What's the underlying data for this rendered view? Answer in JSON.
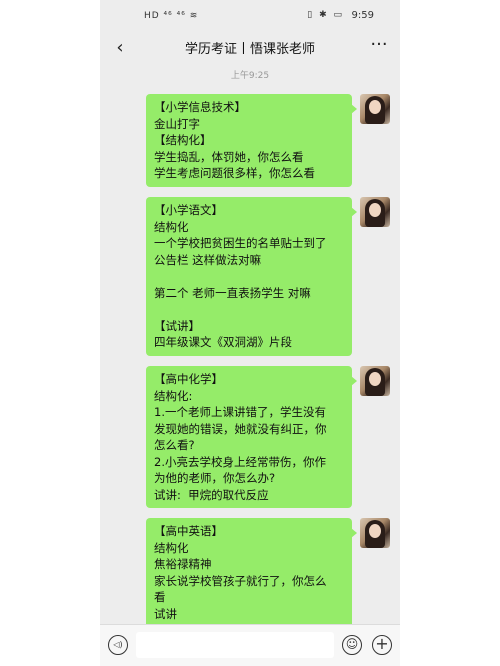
{
  "status": {
    "left_icons": "HD ⁴⁶ ⁴⁶ ≋",
    "right_icons": "▯ ✱ ▭",
    "time": "9:59"
  },
  "header": {
    "back_icon": "‹",
    "title": "学历考证丨悟课张老师",
    "more_icon": "···"
  },
  "timestamp": "上午9:25",
  "messages": [
    {
      "lines": [
        "【小学信息技术】",
        "金山打字",
        "【结构化】",
        "学生捣乱，体罚她，你怎么看",
        "学生考虑问题很多样，你怎么看"
      ]
    },
    {
      "lines": [
        "【小学语文】",
        "结构化",
        "一个学校把贫困生的名单贴士到了",
        "公告栏 这样做法对嘛",
        "",
        "第二个 老师一直表扬学生 对嘛",
        "",
        "【试讲】",
        "四年级课文《双洞湖》片段"
      ]
    },
    {
      "lines": [
        "【高中化学】",
        "结构化:",
        "1.一个老师上课讲错了，学生没有",
        "发现她的错误，她就没有纠正，你",
        "怎么看?",
        "2.小亮去学校身上经常带伤，你作",
        "为他的老师，你怎么办?",
        "试讲:  甲烷的取代反应"
      ]
    },
    {
      "lines": [
        "【高中英语】",
        "结构化",
        "焦裕禄精神",
        "家长说学校管孩子就行了，你怎么",
        "看",
        "试讲"
      ]
    }
  ],
  "bottom": {
    "voice_icon": "◁)",
    "emoji_icon": "☺",
    "plus_icon": "+"
  }
}
